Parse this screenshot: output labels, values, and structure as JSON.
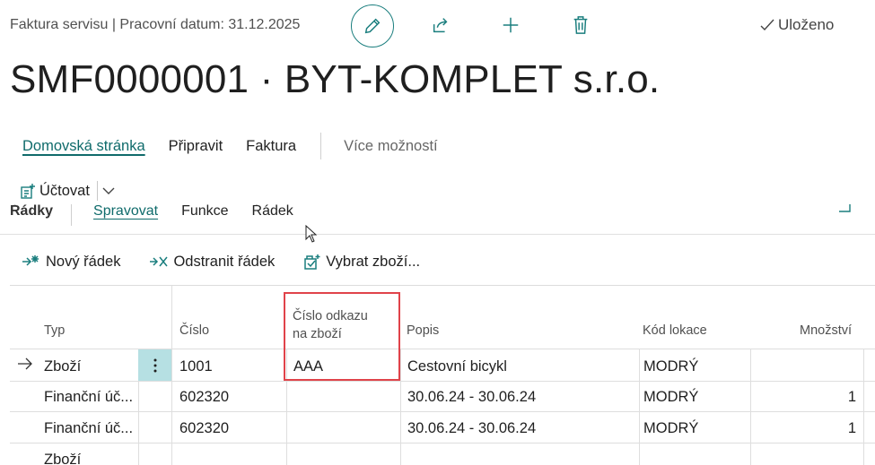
{
  "header": {
    "context": "Faktura servisu | Pracovní datum: 31.12.2025",
    "status": "Uloženo",
    "icons": [
      "edit-icon",
      "share-icon",
      "add-icon",
      "delete-icon",
      "check-icon"
    ],
    "accent_color": "#1a7e7e"
  },
  "page": {
    "title": "SMF0000001 · BYT-KOMPLET s.r.o."
  },
  "actionbar": {
    "items": [
      "Domovská stránka",
      "Připravit",
      "Faktura"
    ],
    "more": "Více možností"
  },
  "promoted": {
    "post_label": "Účtovat"
  },
  "lines": {
    "title": "Řádky",
    "tabs": [
      "Spravovat",
      "Funkce",
      "Řádek"
    ],
    "actions": {
      "new_line": "Nový řádek",
      "delete_line": "Odstranit řádek",
      "select_items": "Vybrat zboží..."
    },
    "columns": {
      "type": "Typ",
      "number": "Číslo",
      "item_ref_line1": "Číslo odkazu",
      "item_ref_line2": "na zboží",
      "description": "Popis",
      "location": "Kód lokace",
      "quantity": "Množství"
    },
    "rows": [
      {
        "type": "Zboží",
        "number": "1001",
        "item_ref": "AAA",
        "description": "Cestovní bicykl",
        "location": "MODRÝ",
        "quantity": ""
      },
      {
        "type": "Finanční úč...",
        "number": "602320",
        "item_ref": "",
        "description": "30.06.24 - 30.06.24",
        "location": "MODRÝ",
        "quantity": "1"
      },
      {
        "type": "Finanční úč...",
        "number": "602320",
        "item_ref": "",
        "description": "30.06.24 - 30.06.24",
        "location": "MODRÝ",
        "quantity": "1"
      },
      {
        "type": "Zboží",
        "number": "",
        "item_ref": "",
        "description": "",
        "location": "",
        "quantity": ""
      }
    ]
  },
  "highlight_color": "#e0434a"
}
